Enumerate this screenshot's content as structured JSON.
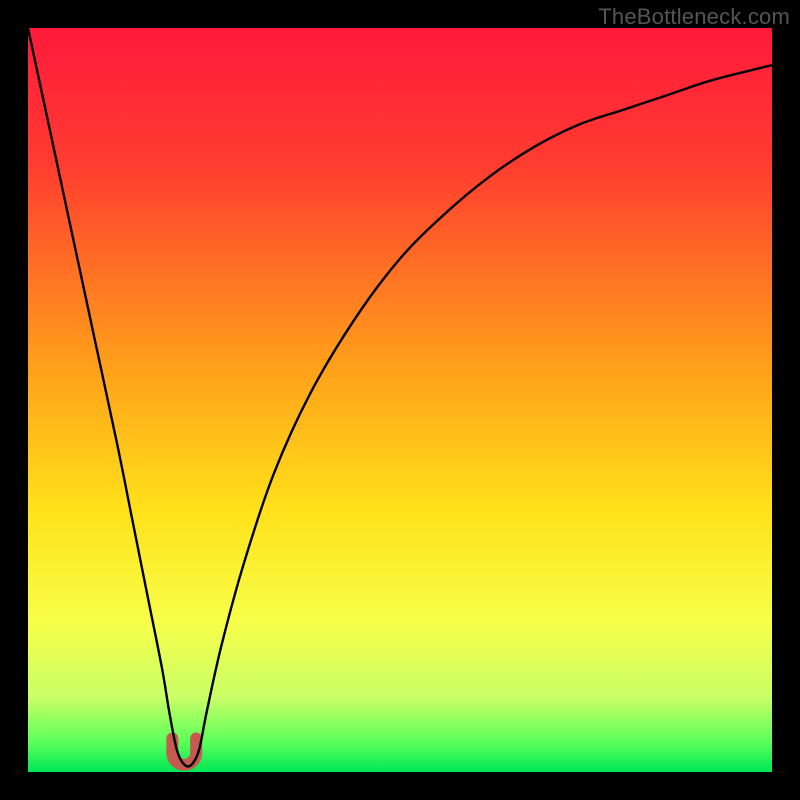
{
  "watermark": {
    "text": "TheBottleneck.com"
  },
  "chart_data": {
    "type": "line",
    "title": "",
    "xlabel": "",
    "ylabel": "",
    "xlim": [
      0,
      100
    ],
    "ylim": [
      0,
      100
    ],
    "gradient_stops": [
      {
        "offset": 0,
        "color": "#ff1a3c"
      },
      {
        "offset": 18,
        "color": "#ff3b30"
      },
      {
        "offset": 45,
        "color": "#ff9e1a"
      },
      {
        "offset": 65,
        "color": "#ffe21a"
      },
      {
        "offset": 80,
        "color": "#f7ff4a"
      },
      {
        "offset": 90,
        "color": "#c8ff66"
      },
      {
        "offset": 96,
        "color": "#5bff5b"
      },
      {
        "offset": 100,
        "color": "#00e756"
      }
    ],
    "series": [
      {
        "name": "bottleneck-curve",
        "x": [
          0,
          3,
          6,
          9,
          12,
          14,
          16,
          18,
          19,
          20,
          21,
          22,
          23,
          24,
          26,
          29,
          33,
          38,
          44,
          50,
          56,
          62,
          68,
          74,
          80,
          86,
          92,
          100
        ],
        "values": [
          100,
          86,
          72,
          58,
          44,
          34,
          24,
          14,
          8,
          3,
          1,
          1,
          3,
          8,
          17,
          28,
          40,
          51,
          61,
          69,
          75,
          80,
          84,
          87,
          89,
          91,
          93,
          95
        ]
      }
    ],
    "marker": {
      "name": "minimum-region",
      "shape": "u",
      "x_center": 21,
      "x_width": 3.2,
      "y_top": 4.5,
      "y_bottom": 0,
      "color": "#c55a51",
      "stroke_width_px": 12
    }
  }
}
